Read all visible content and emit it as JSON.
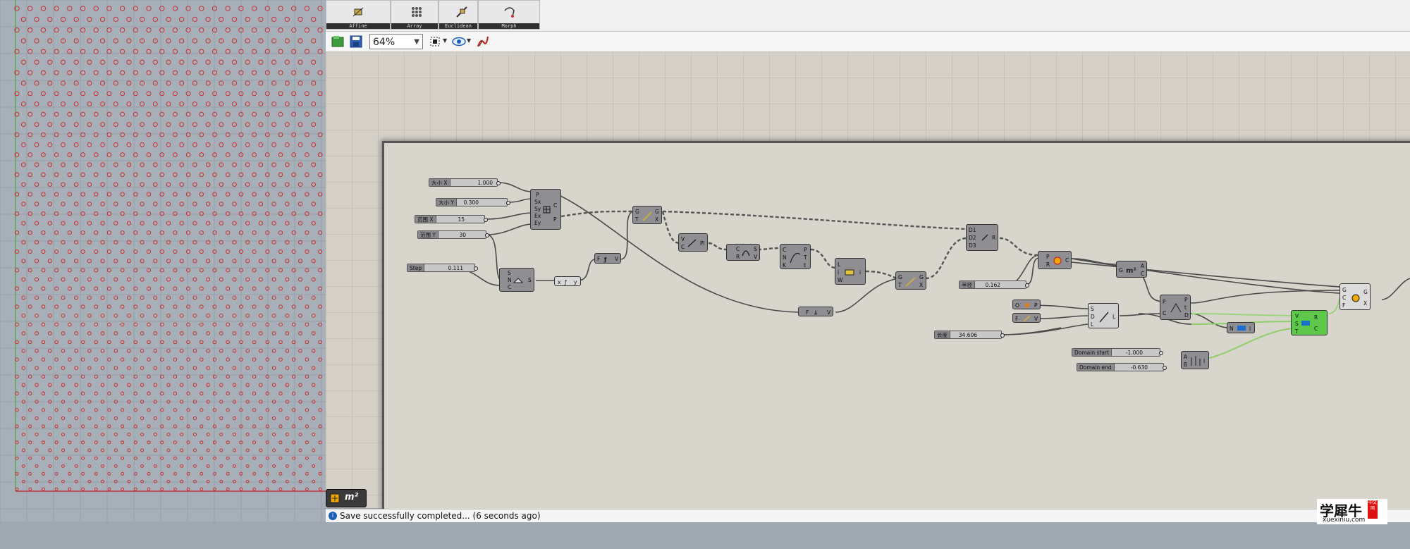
{
  "ribbon": {
    "panels": [
      {
        "caption": "Affine",
        "icon": "affine-transform-icon"
      },
      {
        "caption": "Array",
        "icon": "array-icon"
      },
      {
        "caption": "Euclidean",
        "icon": "euclidean-icon"
      },
      {
        "caption": "Morph",
        "icon": "morph-icon"
      }
    ]
  },
  "toolbar": {
    "zoom": "64%"
  },
  "canvas": {
    "sliders": [
      {
        "name": "大小 X",
        "value": "1.000"
      },
      {
        "name": "大小 Y",
        "value": "0.300"
      },
      {
        "name": "范围 X",
        "value": "15"
      },
      {
        "name": "范围 Y",
        "value": "30"
      },
      {
        "name": "Step",
        "value": "0.111"
      },
      {
        "name": "半径",
        "value": "0.162"
      },
      {
        "name": "长度",
        "value": "34.606"
      },
      {
        "name": "Domain start",
        "value": "-1.000"
      },
      {
        "name": "Domain end",
        "value": "-0.630"
      }
    ]
  },
  "widget": {
    "label": "m²"
  },
  "status": {
    "message": "Save successfully completed... (6 seconds ago)"
  },
  "watermark": {
    "brand": "学犀牛",
    "seal": "中文网",
    "url": "xuexiniu.com"
  },
  "colors": {
    "canvas_bg": "#d4d0c8",
    "viewport_bg": "#a7b0b9",
    "circle_red": "#d02020",
    "component_gray": "#8e8e93",
    "active_green": "#5dc84a"
  }
}
